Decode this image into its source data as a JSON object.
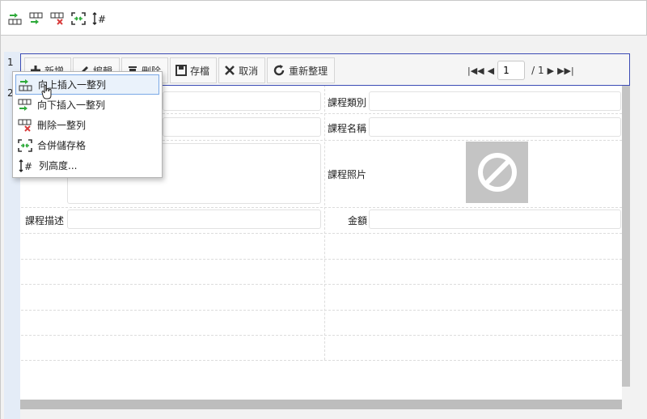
{
  "top_toolbar": {
    "icons": [
      "insert-row-above-icon",
      "insert-row-below-icon",
      "delete-row-icon",
      "merge-cells-icon",
      "row-height-icon"
    ]
  },
  "row_numbers": [
    "1",
    "2"
  ],
  "toolbar": {
    "add_label": "新增",
    "edit_label": "編輯",
    "delete_label": "刪除",
    "save_label": "存檔",
    "cancel_label": "取消",
    "refresh_label": "重新整理"
  },
  "pager": {
    "current_page": "1",
    "total_label": "/ 1"
  },
  "form": {
    "course_category_label": "課程類別",
    "course_name_label": "課程名稱",
    "course_photo_label": "課程照片",
    "course_description_label": "課程描述",
    "amount_label": "金額"
  },
  "context_menu": {
    "items": [
      {
        "label": "向上插入一整列",
        "icon": "insert-row-above-icon"
      },
      {
        "label": "向下插入一整列",
        "icon": "insert-row-below-icon"
      },
      {
        "label": "刪除一整列",
        "icon": "delete-row-icon"
      },
      {
        "label": "合併儲存格",
        "icon": "merge-cells-icon"
      },
      {
        "label": "列高度...",
        "icon": "row-height-icon"
      }
    ]
  },
  "colors": {
    "green": "#2eaa3a",
    "red": "#d83b3b",
    "selection_border": "#3b4bb5",
    "menu_hover": "#eaf2fb"
  }
}
